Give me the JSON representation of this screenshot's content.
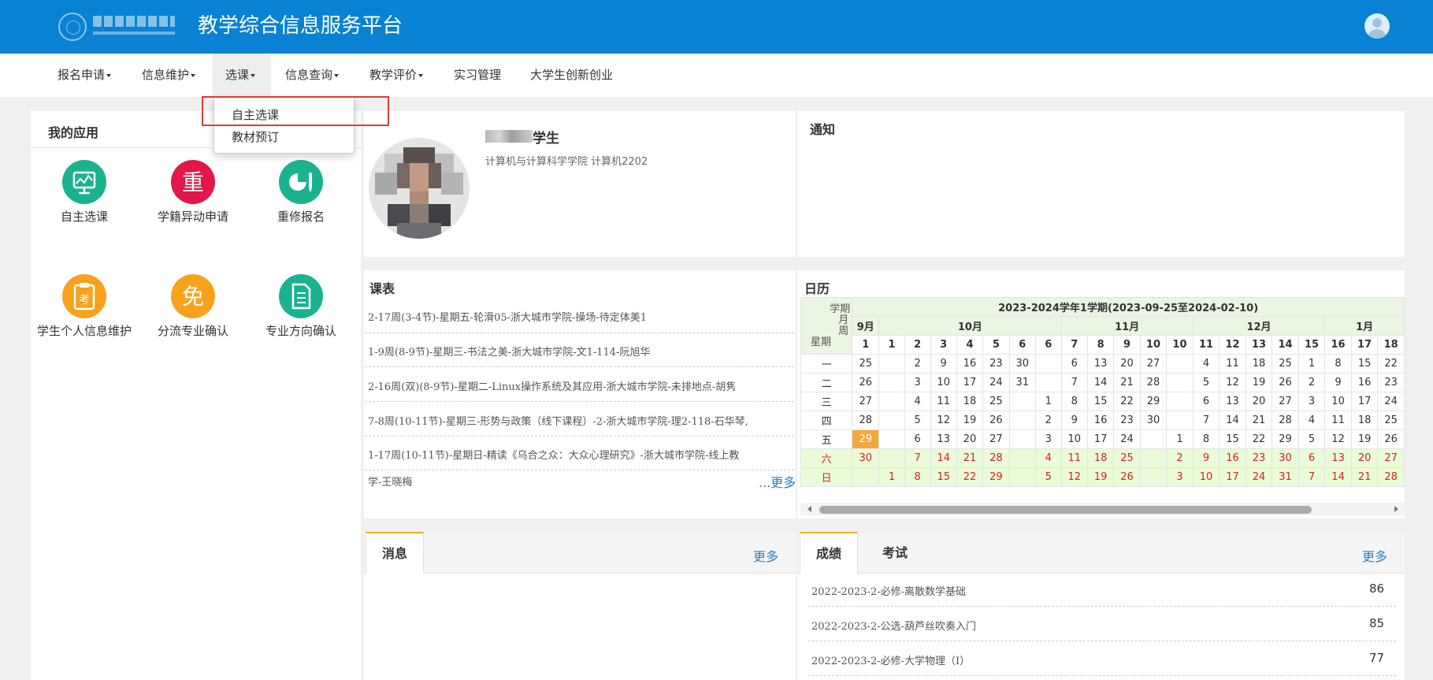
{
  "header": {
    "site_title": "教学综合信息服务平台",
    "logo_alt": "浙大城市学院"
  },
  "nav": {
    "items": [
      {
        "label": "报名申请",
        "caret": true
      },
      {
        "label": "信息维护",
        "caret": true
      },
      {
        "label": "选课",
        "caret": true,
        "active": true
      },
      {
        "label": "信息查询",
        "caret": true
      },
      {
        "label": "教学评价",
        "caret": true
      },
      {
        "label": "实习管理",
        "caret": false
      },
      {
        "label": "大学生创新创业",
        "caret": false
      }
    ],
    "dropdown": [
      "自主选课",
      "教材预订"
    ]
  },
  "my_apps": {
    "title": "我的应用",
    "items": [
      {
        "label": "自主选课",
        "icon": "presentation-chart-icon",
        "color": "#1bb38f"
      },
      {
        "label": "学籍异动申请",
        "icon": "zhong-character-icon",
        "color": "#e2174a"
      },
      {
        "label": "重修报名",
        "icon": "pie-pencil-icon",
        "color": "#1bb38f"
      },
      {
        "label": "学生个人信息维护",
        "icon": "clipboard-kao-icon",
        "color": "#f6a21d"
      },
      {
        "label": "分流专业确认",
        "icon": "mian-character-icon",
        "color": "#f6a21d"
      },
      {
        "label": "专业方向确认",
        "icon": "document-icon",
        "color": "#1bb38f"
      }
    ]
  },
  "profile": {
    "name_suffix": "学生",
    "dept": "计算机与计算科学学院 计算机2202"
  },
  "notice": {
    "title": "通知"
  },
  "schedule": {
    "title": "课表",
    "more": "...更多",
    "lines": [
      "2-17周(3-4节)-星期五-轮滑05-浙大城市学院-操场-待定体美1",
      "1-9周(8-9节)-星期三-书法之美-浙大城市学院-文1-114-阮旭华",
      "2-16周(双)(8-9节)-星期二-Linux操作系统及其应用-浙大城市学院-未排地点-胡隽",
      "7-8周(10-11节)-星期三-形势与政策（线下课程）-2-浙大城市学院-理2-118-石华琴,",
      "1-17周(10-11节)-星期日-精读《乌合之众：大众心理研究》-浙大城市学院-线上教",
      "学-王晓梅"
    ]
  },
  "calendar": {
    "title": "日历",
    "term_title": "2023-2024学年1学期(2023-09-25至2024-02-10)",
    "corner": {
      "term": "学期",
      "month": "月",
      "week": "周",
      "weekday": "星期"
    },
    "months": [
      {
        "label": "9月",
        "span": 1
      },
      {
        "label": "10月",
        "span": 7
      },
      {
        "label": "11月",
        "span": 5
      },
      {
        "label": "12月",
        "span": 5
      },
      {
        "label": "1月",
        "span": 4
      }
    ],
    "weeks": [
      "1",
      "1",
      "2",
      "3",
      "4",
      "5",
      "6",
      "6",
      "7",
      "8",
      "9",
      "10",
      "10",
      "11",
      "12",
      "13",
      "14",
      "15",
      "16",
      "17",
      "18"
    ],
    "days": [
      {
        "name": "一",
        "vals": [
          "25",
          "",
          "2",
          "9",
          "16",
          "23",
          "30",
          "",
          "6",
          "13",
          "20",
          "27",
          "",
          "4",
          "11",
          "18",
          "25",
          "1",
          "8",
          "15",
          "22"
        ]
      },
      {
        "name": "二",
        "vals": [
          "26",
          "",
          "3",
          "10",
          "17",
          "24",
          "31",
          "",
          "7",
          "14",
          "21",
          "28",
          "",
          "5",
          "12",
          "19",
          "26",
          "2",
          "9",
          "16",
          "23"
        ]
      },
      {
        "name": "三",
        "vals": [
          "27",
          "",
          "4",
          "11",
          "18",
          "25",
          "",
          "1",
          "8",
          "15",
          "22",
          "29",
          "",
          "6",
          "13",
          "20",
          "27",
          "3",
          "10",
          "17",
          "24"
        ]
      },
      {
        "name": "四",
        "vals": [
          "28",
          "",
          "5",
          "12",
          "19",
          "26",
          "",
          "2",
          "9",
          "16",
          "23",
          "30",
          "",
          "7",
          "14",
          "21",
          "28",
          "4",
          "11",
          "18",
          "25"
        ]
      },
      {
        "name": "五",
        "vals": [
          "29",
          "",
          "6",
          "13",
          "20",
          "27",
          "",
          "3",
          "10",
          "17",
          "24",
          "",
          "1",
          "8",
          "15",
          "22",
          "29",
          "5",
          "12",
          "19",
          "26"
        ]
      },
      {
        "name": "六",
        "vals": [
          "30",
          "",
          "7",
          "14",
          "21",
          "28",
          "",
          "4",
          "11",
          "18",
          "25",
          "",
          "2",
          "9",
          "16",
          "23",
          "30",
          "6",
          "13",
          "20",
          "27"
        ]
      },
      {
        "name": "日",
        "vals": [
          "",
          "1",
          "8",
          "15",
          "22",
          "29",
          "",
          "5",
          "12",
          "19",
          "26",
          "",
          "3",
          "10",
          "17",
          "24",
          "31",
          "7",
          "14",
          "21",
          "28"
        ]
      }
    ],
    "highlight_date": "29"
  },
  "messages": {
    "tab": "消息",
    "more": "更多"
  },
  "grades": {
    "tabs": [
      "成绩",
      "考试"
    ],
    "more": "更多",
    "rows": [
      {
        "name": "2022-2023-2-必修-离散数学基础",
        "score": "86"
      },
      {
        "name": "2022-2023-2-公选-葫芦丝吹奏入门",
        "score": "85"
      },
      {
        "name": "2022-2023-2-必修-大学物理（Ⅰ）",
        "score": "77"
      }
    ]
  }
}
